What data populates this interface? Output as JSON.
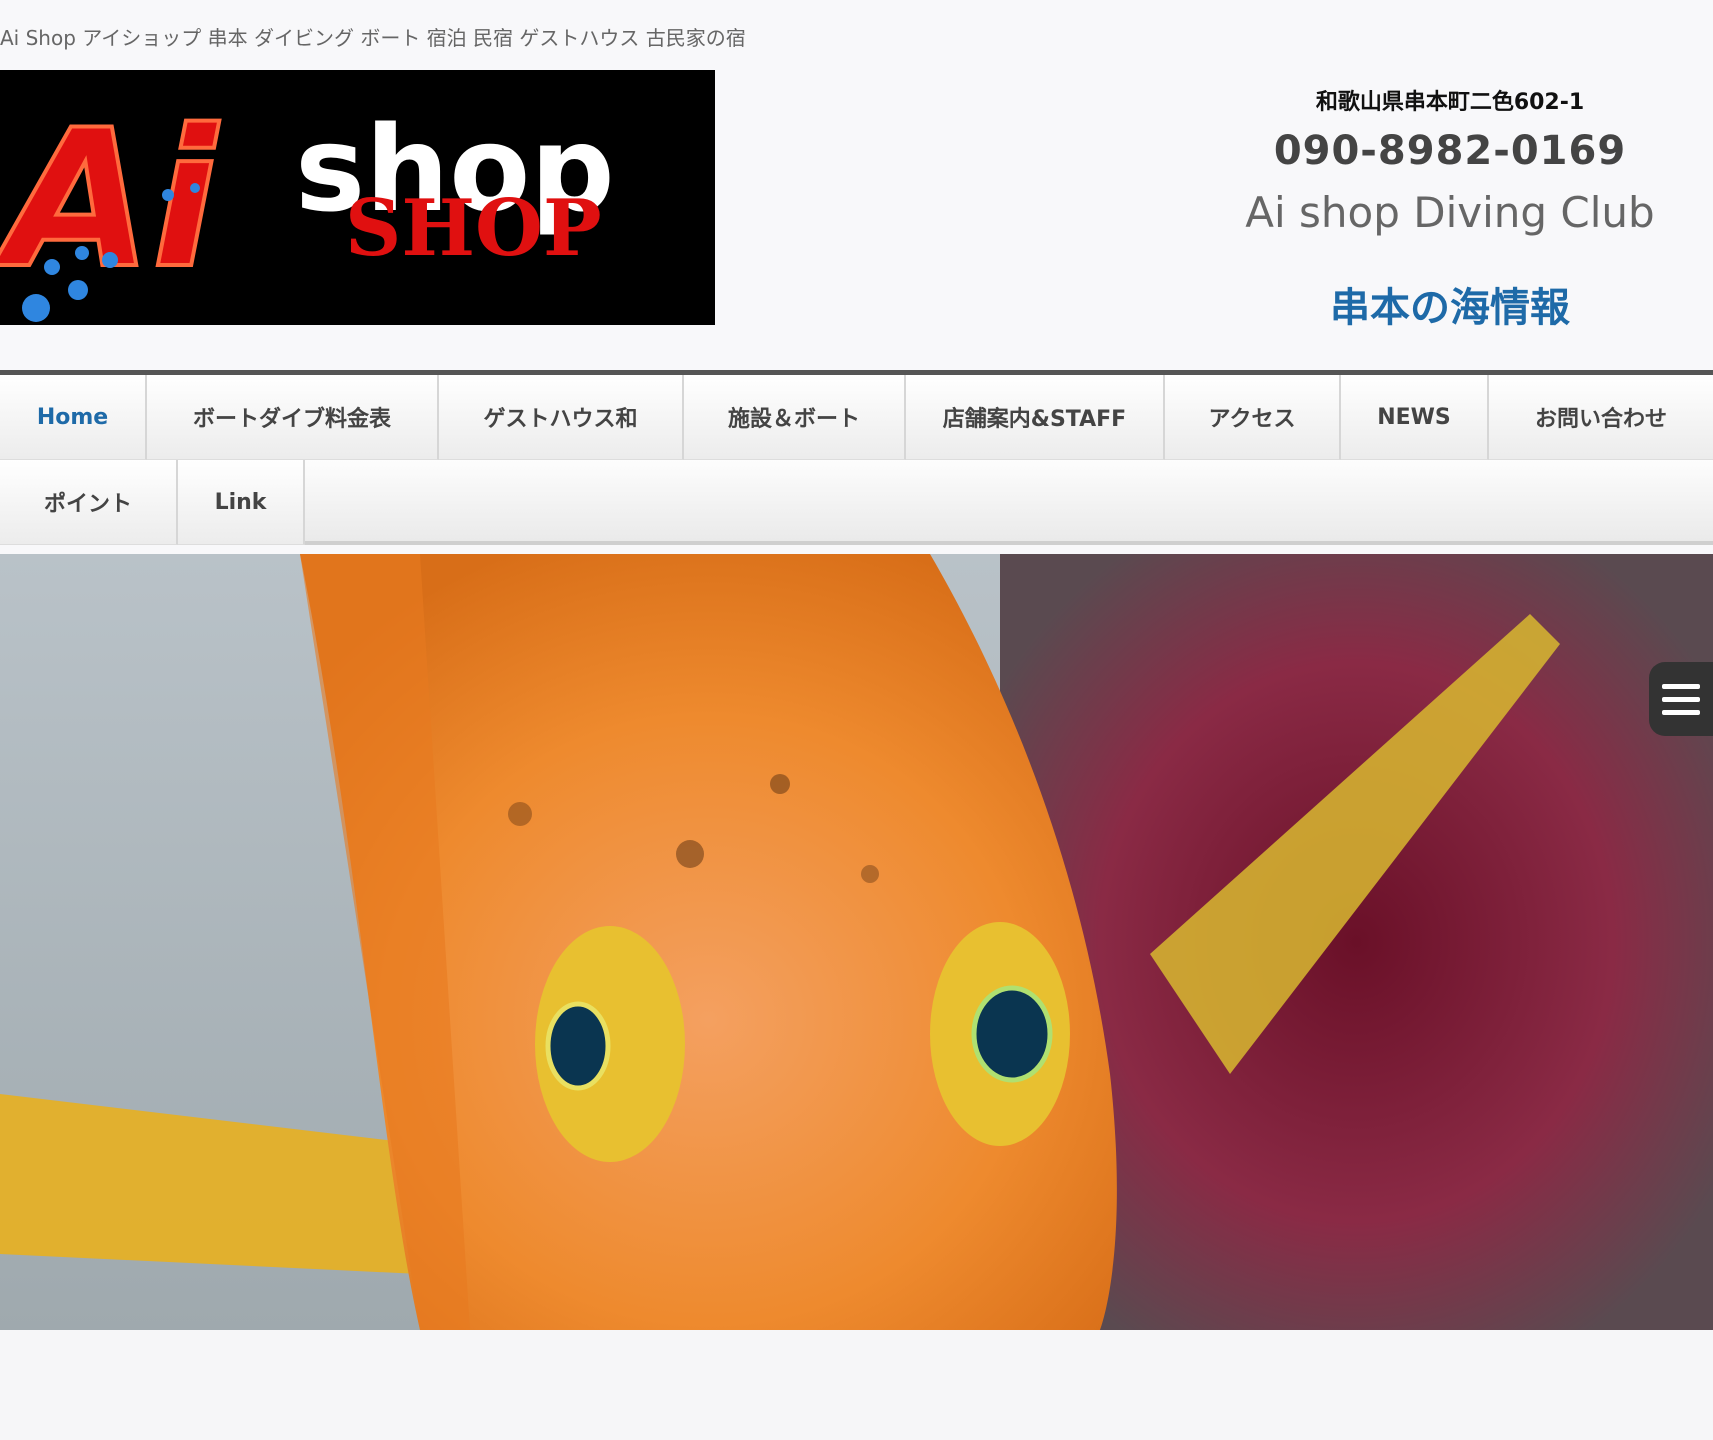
{
  "header": {
    "tagline": "Ai Shop アイショップ 串本 ダイビング ボート 宿泊 民宿 ゲストハウス 古民家の宿",
    "logo_text_main": "Ai",
    "logo_text_shop": "shop",
    "logo_text_sub": "SHOP"
  },
  "contact": {
    "address": "和歌山県串本町二色602-1",
    "phone": "090-8982-0169",
    "club_name": "Ai shop Diving Club",
    "sea_info_link": "串本の海情報"
  },
  "nav": {
    "row1": [
      "Home",
      "ボートダイブ料金表",
      "ゲストハウス和",
      "施設＆ボート",
      "店舗案内&STAFF",
      "アクセス",
      "NEWS",
      "お問い合わせ"
    ],
    "row2": [
      "ポイント",
      "Link"
    ],
    "active": "Home"
  },
  "hero": {
    "subject": "orange fish close-up underwater photo"
  },
  "icons": {
    "menu": "hamburger-menu-icon"
  },
  "colors": {
    "link_blue": "#1e6aa8",
    "nav_border": "#555555",
    "logo_red": "#e01010"
  }
}
